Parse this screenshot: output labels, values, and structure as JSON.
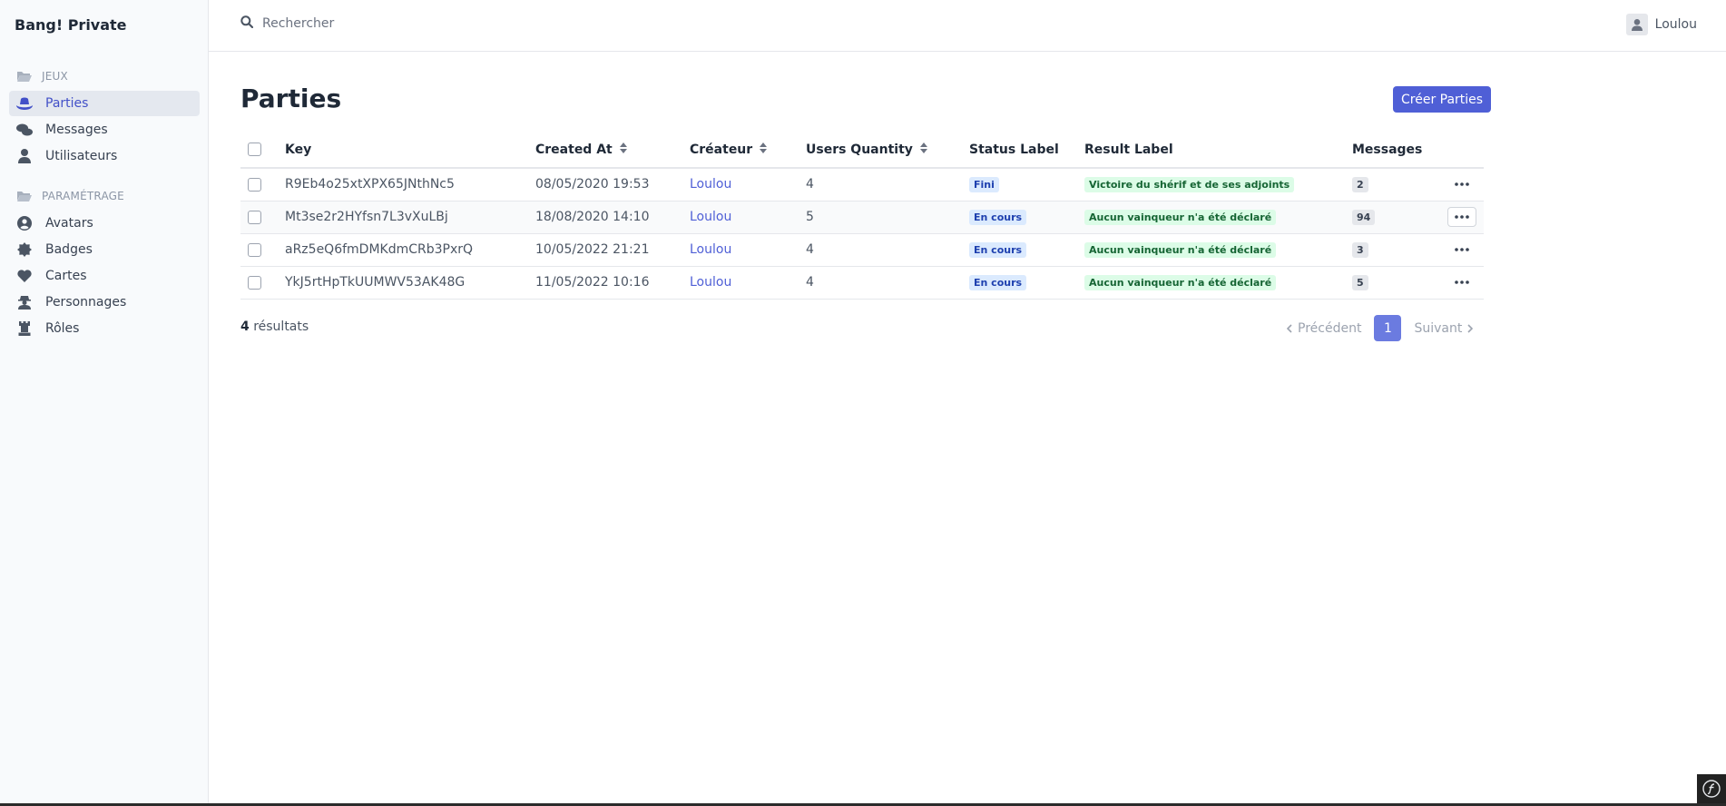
{
  "sidebar": {
    "brand": "Bang! Private",
    "sections": [
      {
        "label": "JEUX"
      },
      {
        "label": "PARAMÉTRAGE"
      }
    ],
    "items": [
      {
        "label": "Parties",
        "icon": "hat-icon"
      },
      {
        "label": "Messages",
        "icon": "comments-icon"
      },
      {
        "label": "Utilisateurs",
        "icon": "user-icon"
      },
      {
        "label": "Avatars",
        "icon": "user-circle-icon"
      },
      {
        "label": "Badges",
        "icon": "certificate-icon"
      },
      {
        "label": "Cartes",
        "icon": "heart-icon"
      },
      {
        "label": "Personnages",
        "icon": "user-secret-icon"
      },
      {
        "label": "Rôles",
        "icon": "chess-rook-icon"
      }
    ]
  },
  "header": {
    "search_placeholder": "Rechercher",
    "user_name": "Loulou"
  },
  "main": {
    "title": "Parties",
    "create_button": "Créer Parties",
    "columns": [
      "Key",
      "Created At",
      "Créateur",
      "Users Quantity",
      "Status Label",
      "Result Label",
      "Messages"
    ],
    "rows": [
      {
        "key": "R9Eb4o25xtXPX65JNthNc5",
        "created_at": "08/05/2020 19:53",
        "creator": "Loulou",
        "users_quantity": "4",
        "status": "Fini",
        "result": "Victoire du shérif et de ses adjoints",
        "messages": "2"
      },
      {
        "key": "Mt3se2r2HYfsn7L3vXuLBj",
        "created_at": "18/08/2020 14:10",
        "creator": "Loulou",
        "users_quantity": "5",
        "status": "En cours",
        "result": "Aucun vainqueur n'a été déclaré",
        "messages": "94"
      },
      {
        "key": "aRz5eQ6fmDMKdmCRb3PxrQ",
        "created_at": "10/05/2022 21:21",
        "creator": "Loulou",
        "users_quantity": "4",
        "status": "En cours",
        "result": "Aucun vainqueur n'a été déclaré",
        "messages": "3"
      },
      {
        "key": "YkJ5rtHpTkUUMWV53AK48G",
        "created_at": "11/05/2022 10:16",
        "creator": "Loulou",
        "users_quantity": "4",
        "status": "En cours",
        "result": "Aucun vainqueur n'a été déclaré",
        "messages": "5"
      }
    ],
    "results_count": "4",
    "results_label": "résultats",
    "pagination": {
      "prev": "Précédent",
      "current": "1",
      "next": "Suivant"
    }
  },
  "colors": {
    "accent": "#4f5fd6",
    "active_bg": "#e4e8ef"
  }
}
